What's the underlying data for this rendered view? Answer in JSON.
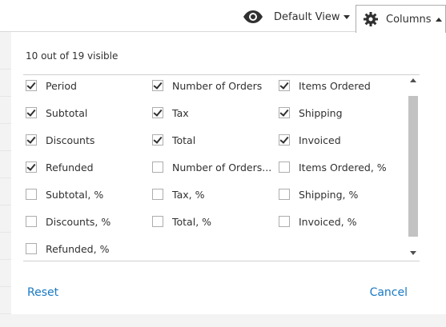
{
  "toolbar": {
    "view_label": "Default View",
    "columns_label": "Columns"
  },
  "panel": {
    "visible_count": "10 out of 19 visible",
    "reset_label": "Reset",
    "cancel_label": "Cancel",
    "options": [
      {
        "label": "Period",
        "checked": true
      },
      {
        "label": "Number of Orders",
        "checked": true
      },
      {
        "label": "Items Ordered",
        "checked": true
      },
      {
        "label": "Subtotal",
        "checked": true
      },
      {
        "label": "Tax",
        "checked": true
      },
      {
        "label": "Shipping",
        "checked": true
      },
      {
        "label": "Discounts",
        "checked": true
      },
      {
        "label": "Total",
        "checked": true
      },
      {
        "label": "Invoiced",
        "checked": true
      },
      {
        "label": "Refunded",
        "checked": true
      },
      {
        "label": "Number of Orders...",
        "checked": false
      },
      {
        "label": "Items Ordered, %",
        "checked": false
      },
      {
        "label": "Subtotal, %",
        "checked": false
      },
      {
        "label": "Tax, %",
        "checked": false
      },
      {
        "label": "Shipping, %",
        "checked": false
      },
      {
        "label": "Discounts, %",
        "checked": false
      },
      {
        "label": "Total, %",
        "checked": false
      },
      {
        "label": "Invoiced, %",
        "checked": false
      },
      {
        "label": "Refunded, %",
        "checked": false
      }
    ]
  },
  "colors": {
    "link": "#1979c3",
    "text": "#303030",
    "scroll_thumb": "#c2c2c2"
  },
  "icons": {
    "view": "eye-icon",
    "columns": "gear-icon"
  }
}
